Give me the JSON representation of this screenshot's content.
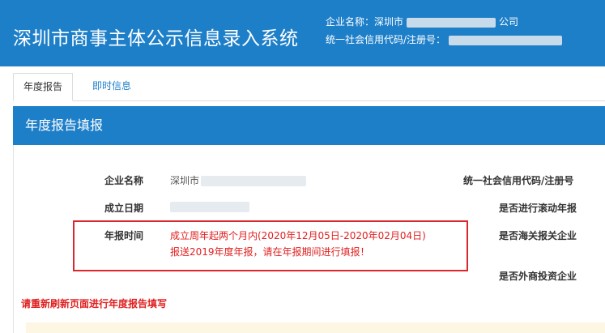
{
  "header": {
    "system_title": "深圳市商事主体公示信息录入系统",
    "company_label": "企业名称：",
    "company_value_prefix": "深圳市",
    "company_value_suffix": "公司",
    "credit_label": "统一社会信用代码/注册号："
  },
  "tabs": [
    {
      "label": "年度报告",
      "active": true
    },
    {
      "label": "即时信息",
      "active": false
    }
  ],
  "panel": {
    "title": "年度报告填报"
  },
  "form": {
    "company_name_label": "企业名称",
    "company_name_prefix": "深圳市",
    "established_label": "成立日期",
    "report_time_label": "年报时间",
    "report_time_line1": "成立周年起两个月内(2020年12月05日-2020年02月04日)",
    "report_time_line2": "报送2019年度年报，请在年报期间进行填报！",
    "credit_code_label": "统一社会信用代码/注册号",
    "rolling_report_label": "是否进行滚动年报",
    "customs_label": "是否海关报关企业",
    "foreign_invest_label": "是否外商投资企业"
  },
  "notice": {
    "refresh_text": "请重新刷新页面进行年度报告填写"
  },
  "colors": {
    "brand_blue": "#1e7fc9",
    "alert_red": "#e02020",
    "box_red": "#d9272e"
  }
}
